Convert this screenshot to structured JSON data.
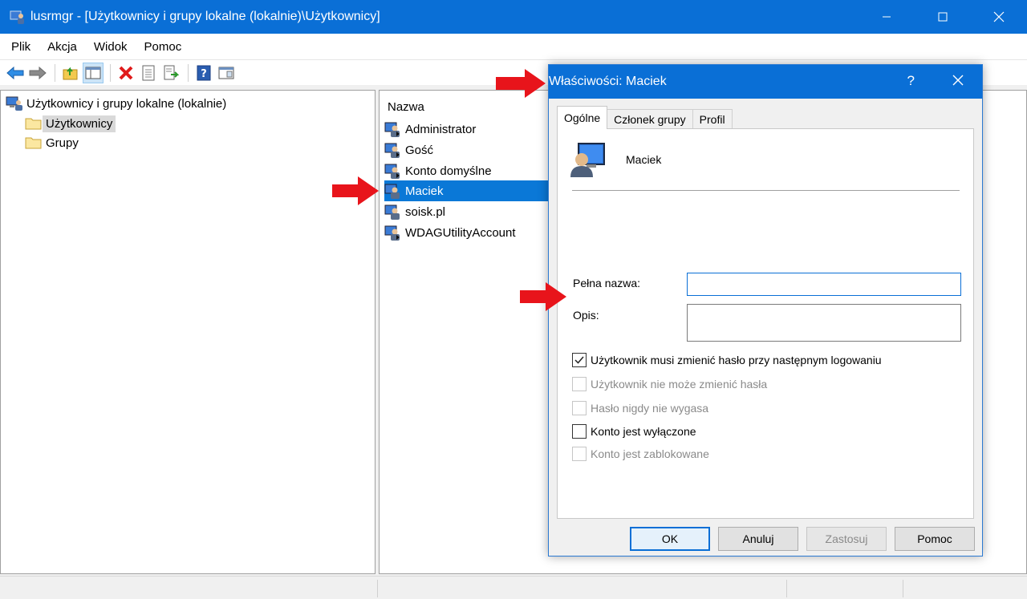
{
  "window": {
    "title": "lusrmgr - [Użytkownicy i grupy lokalne (lokalnie)\\Użytkownicy]"
  },
  "menu": [
    "Plik",
    "Akcja",
    "Widok",
    "Pomoc"
  ],
  "toolbar_icons": [
    "back-icon",
    "forward-icon",
    "up-folder-icon",
    "show-hide-tree-icon",
    "delete-icon",
    "properties-icon",
    "export-list-icon",
    "help-icon",
    "console-view-icon"
  ],
  "tree": {
    "root": "Użytkownicy i grupy lokalne (lokalnie)",
    "children": [
      "Użytkownicy",
      "Grupy"
    ],
    "selected": "Użytkownicy"
  },
  "list": {
    "header": "Nazwa",
    "items": [
      "Administrator",
      "Gość",
      "Konto domyślne",
      "Maciek",
      "soisk.pl",
      "WDAGUtilityAccount"
    ],
    "selected": "Maciek"
  },
  "dialog": {
    "title": "Właściwości: Maciek",
    "help": "?",
    "tabs": [
      "Ogólne",
      "Członek grupy",
      "Profil"
    ],
    "active_tab": "Ogólne",
    "user_name": "Maciek",
    "full_name_label": "Pełna nazwa:",
    "full_name_value": "",
    "description_label": "Opis:",
    "description_value": "",
    "checkboxes": [
      {
        "label": "Użytkownik musi zmienić hasło przy następnym logowaniu",
        "checked": true,
        "enabled": true
      },
      {
        "label": "Użytkownik nie może zmienić hasła",
        "checked": false,
        "enabled": false
      },
      {
        "label": "Hasło nigdy nie wygasa",
        "checked": false,
        "enabled": false
      },
      {
        "label": "Konto jest wyłączone",
        "checked": false,
        "enabled": true
      },
      {
        "label": "Konto jest zablokowane",
        "checked": false,
        "enabled": false
      }
    ],
    "buttons": {
      "ok": "OK",
      "cancel": "Anuluj",
      "apply": "Zastosuj",
      "help": "Pomoc"
    }
  },
  "colors": {
    "titlebar": "#0a6fd6",
    "selection": "#0a78d7",
    "arrow": "#e8141b"
  }
}
